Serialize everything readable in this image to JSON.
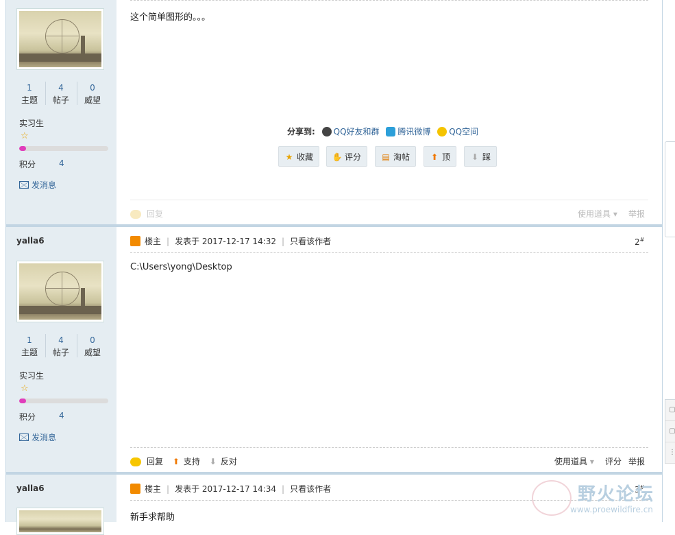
{
  "posts": [
    {
      "author": "",
      "stats": [
        {
          "value": "1",
          "label": "主题"
        },
        {
          "value": "4",
          "label": "帖子"
        },
        {
          "value": "0",
          "label": "威望"
        }
      ],
      "rank": "实习生",
      "score_label": "积分",
      "score": "4",
      "message_link": "发消息",
      "content": "这个简单图形的。。。",
      "share": {
        "label": "分享到:",
        "items": [
          "QQ好友和群",
          "腾讯微博",
          "QQ空间"
        ]
      },
      "actions": [
        "收藏",
        "评分",
        "淘帖",
        "顶",
        "踩"
      ],
      "footer": {
        "reply": "回复",
        "tools": "使用道具",
        "report": "举报"
      }
    },
    {
      "author": "yalla6",
      "stats": [
        {
          "value": "1",
          "label": "主题"
        },
        {
          "value": "4",
          "label": "帖子"
        },
        {
          "value": "0",
          "label": "威望"
        }
      ],
      "rank": "实习生",
      "score_label": "积分",
      "score": "4",
      "message_link": "发消息",
      "meta": {
        "badge": "楼主",
        "posted": "发表于 2017-12-17 14:32",
        "only_author": "只看该作者",
        "floor": "2",
        "floor_mark": "#"
      },
      "content": "C:\\Users\\yong\\Desktop",
      "footer": {
        "reply": "回复",
        "support": "支持",
        "oppose": "反对",
        "tools": "使用道具",
        "rate": "评分",
        "report": "举报"
      }
    },
    {
      "author": "yalla6",
      "meta": {
        "badge": "楼主",
        "posted": "发表于 2017-12-17 14:34",
        "only_author": "只看该作者",
        "floor": "3",
        "floor_mark": "#"
      },
      "content": "新手求帮助"
    }
  ],
  "watermark": {
    "text": "野火论坛",
    "url": "www.proewildfire.cn"
  },
  "colors": {
    "accent": "#336699",
    "separator": "#c2d5e3",
    "sidebar_bg": "#e5edf2",
    "progress": "#e03dbb"
  },
  "icons": {
    "share": [
      "qq-icon",
      "tencent-weibo-icon",
      "qzone-icon"
    ],
    "actions": [
      "star-icon",
      "thumb-icon",
      "tray-icon",
      "arrow-up-icon",
      "arrow-down-icon"
    ]
  }
}
